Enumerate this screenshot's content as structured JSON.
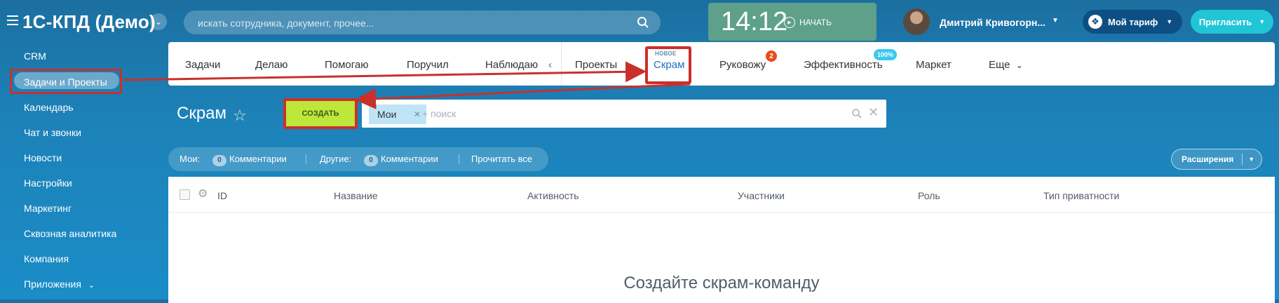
{
  "header": {
    "logo": "1С-КПД (Демо)",
    "search_placeholder": "искать сотрудника, документ, прочее...",
    "clock_time": "14:12",
    "clock_action": "НАЧАТЬ",
    "user_name": "Дмитрий Кривогорн...",
    "tariff_label": "Мой тариф",
    "invite_label": "Пригласить"
  },
  "sidebar": {
    "items": [
      {
        "label": "CRM"
      },
      {
        "label": "Задачи и Проекты"
      },
      {
        "label": "Календарь"
      },
      {
        "label": "Чат и звонки"
      },
      {
        "label": "Новости"
      },
      {
        "label": "Настройки"
      },
      {
        "label": "Маркетинг"
      },
      {
        "label": "Сквозная аналитика"
      },
      {
        "label": "Компания"
      },
      {
        "label": "Приложения"
      }
    ]
  },
  "tabs": {
    "items": [
      {
        "label": "Задачи"
      },
      {
        "label": "Делаю"
      },
      {
        "label": "Помогаю"
      },
      {
        "label": "Поручил"
      },
      {
        "label": "Наблюдаю"
      },
      {
        "label": "Проекты"
      },
      {
        "label": "Скрам"
      },
      {
        "label": "Руковожу"
      },
      {
        "label": "Эффективность"
      },
      {
        "label": "Маркет"
      },
      {
        "label": "Еще"
      }
    ],
    "new_label": "НОВОЕ",
    "badge_count": "2",
    "efficiency_badge": "100%"
  },
  "page": {
    "title": "Скрам",
    "create_label": "СОЗДАТЬ",
    "filter_chip": "Мои",
    "filter_placeholder": "+ поиск"
  },
  "counters": {
    "mine_label": "Мои:",
    "mine_count": "0",
    "mine_comments": "Комментарии",
    "others_label": "Другие:",
    "others_count": "0",
    "others_comments": "Комментарии",
    "read_all": "Прочитать все"
  },
  "extensions_label": "Расширения",
  "table": {
    "columns": [
      "ID",
      "Название",
      "Активность",
      "Участники",
      "Роль",
      "Тип приватности"
    ],
    "empty_message": "Создайте скрам-команду"
  },
  "colors": {
    "highlight": "#c9302c",
    "create_button": "#bde73a",
    "invite_button": "#20c6d6",
    "clock_bg": "#5ea08a"
  }
}
